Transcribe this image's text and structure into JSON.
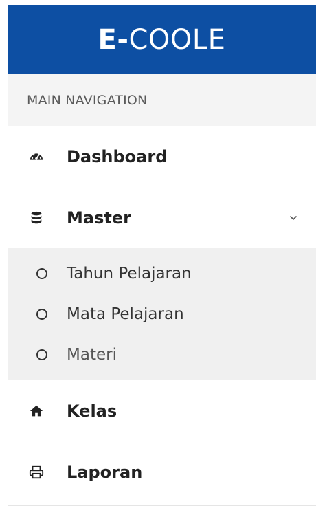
{
  "brand": {
    "bold": "E-",
    "rest": "COOLE",
    "color": "#0d4fa3"
  },
  "nav": {
    "section_label": "MAIN NAVIGATION",
    "items": [
      {
        "label": "Dashboard",
        "icon": "dashboard-icon"
      },
      {
        "label": "Master",
        "icon": "database-icon",
        "expanded": true
      },
      {
        "label": "Kelas",
        "icon": "home-icon"
      },
      {
        "label": "Laporan",
        "icon": "print-icon"
      }
    ],
    "master_children": [
      {
        "label": "Tahun Pelajaran",
        "icon": "circle-icon"
      },
      {
        "label": "Mata Pelajaran",
        "icon": "circle-icon"
      },
      {
        "label": "Materi",
        "icon": "circle-icon"
      }
    ]
  }
}
